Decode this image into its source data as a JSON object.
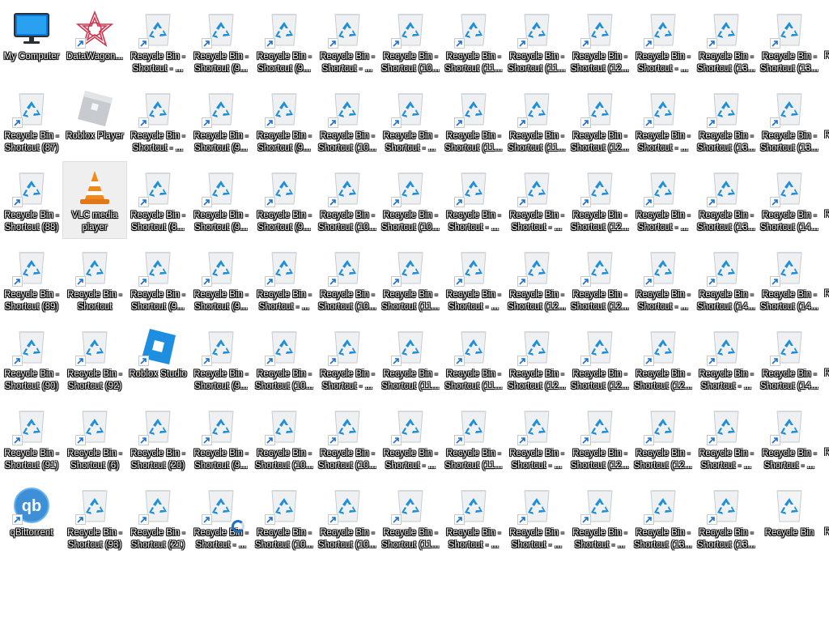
{
  "desktop": {
    "columns": [
      [
        "My Computer",
        "Recycle Bin - Shortcut (87)",
        "Recycle Bin - Shortcut (88)",
        "Recycle Bin - Shortcut (89)",
        "Recycle Bin - Shortcut (90)",
        "Recycle Bin - Shortcut (91)",
        "qBittorrent"
      ],
      [
        "DataWagon...",
        "Roblox Player",
        "VLC media player",
        "Recycle Bin - Shortcut",
        "Recycle Bin - Shortcut (92)",
        "Recycle Bin - Shortcut (6)",
        "Recycle Bin - Shortcut (93)"
      ],
      [
        "Recycle Bin - Shortcut - ...",
        "Recycle Bin - Shortcut - ...",
        "Recycle Bin - Shortcut (8...",
        "Recycle Bin - Shortcut (9...",
        "Roblox Studio",
        "Recycle Bin - Shortcut (20)",
        "Recycle Bin - Shortcut (21)"
      ],
      [
        "Recycle Bin - Shortcut (9...",
        "Recycle Bin - Shortcut (9...",
        "Recycle Bin - Shortcut (9...",
        "Recycle Bin - Shortcut (9...",
        "Recycle Bin - Shortcut (9...",
        "Recycle Bin - Shortcut (9...",
        "Recycle Bin - Shortcut - ..."
      ],
      [
        "Recycle Bin - Shortcut (9...",
        "Recycle Bin - Shortcut (9...",
        "Recycle Bin - Shortcut (9...",
        "Recycle Bin - Shortcut - ...",
        "Recycle Bin - Shortcut (10...",
        "Recycle Bin - Shortcut (10...",
        "Recycle Bin - Shortcut (10..."
      ],
      [
        "Recycle Bin - Shortcut - ...",
        "Recycle Bin - Shortcut (10...",
        "Recycle Bin - Shortcut (10...",
        "Recycle Bin - Shortcut (10...",
        "Recycle Bin - Shortcut - ...",
        "Recycle Bin - Shortcut (10...",
        "Recycle Bin - Shortcut (10..."
      ],
      [
        "Recycle Bin - Shortcut (10...",
        "Recycle Bin - Shortcut - ...",
        "Recycle Bin - Shortcut (10...",
        "Recycle Bin - Shortcut (11...",
        "Recycle Bin - Shortcut (11...",
        "Recycle Bin - Shortcut - ...",
        "Recycle Bin - Shortcut (11..."
      ],
      [
        "Recycle Bin - Shortcut (11...",
        "Recycle Bin - Shortcut (11...",
        "Recycle Bin - Shortcut - ...",
        "Recycle Bin - Shortcut - ...",
        "Recycle Bin - Shortcut (11...",
        "Recycle Bin - Shortcut (11...",
        "Recycle Bin - Shortcut - ..."
      ],
      [
        "Recycle Bin - Shortcut (11...",
        "Recycle Bin - Shortcut (11...",
        "Recycle Bin - Shortcut - ...",
        "Recycle Bin - Shortcut (12...",
        "Recycle Bin - Shortcut (12...",
        "Recycle Bin - Shortcut - ...",
        "Recycle Bin - Shortcut - ..."
      ],
      [
        "Recycle Bin - Shortcut (12...",
        "Recycle Bin - Shortcut (12...",
        "Recycle Bin - Shortcut (12...",
        "Recycle Bin - Shortcut (12...",
        "Recycle Bin - Shortcut (12...",
        "Recycle Bin - Shortcut (12...",
        "Recycle Bin - Shortcut - ..."
      ],
      [
        "Recycle Bin - Shortcut - ...",
        "Recycle Bin - Shortcut - ...",
        "Recycle Bin - Shortcut - ...",
        "Recycle Bin - Shortcut - ...",
        "Recycle Bin - Shortcut (12...",
        "Recycle Bin - Shortcut (12...",
        "Recycle Bin - Shortcut (13..."
      ],
      [
        "Recycle Bin - Shortcut (13...",
        "Recycle Bin - Shortcut (13...",
        "Recycle Bin - Shortcut (13...",
        "Recycle Bin - Shortcut (14...",
        "Recycle Bin - Shortcut - ...",
        "Recycle Bin - Shortcut - ...",
        "Recycle Bin - Shortcut (13..."
      ],
      [
        "Recycle Bin - Shortcut (13...",
        "Recycle Bin - Shortcut (13...",
        "Recycle Bin - Shortcut (14...",
        "Recycle Bin - Shortcut (14...",
        "Recycle Bin - Shortcut (14...",
        "Recycle Bin - Shortcut - ...",
        "Recycle Bin"
      ]
    ],
    "icon_types": [
      [
        "monitor",
        "recycle-shortcut",
        "recycle-shortcut",
        "recycle-shortcut",
        "recycle-shortcut",
        "recycle-shortcut",
        "qbittorrent"
      ],
      [
        "datawagon",
        "roblox-player",
        "vlc",
        "recycle-shortcut",
        "recycle-shortcut",
        "recycle-shortcut",
        "recycle-shortcut"
      ],
      [
        "recycle-shortcut",
        "recycle-shortcut",
        "recycle-shortcut",
        "recycle-shortcut",
        "roblox-studio",
        "recycle-shortcut",
        "recycle-shortcut"
      ],
      [
        "recycle-shortcut",
        "recycle-shortcut",
        "recycle-shortcut",
        "recycle-shortcut",
        "recycle-shortcut",
        "recycle-shortcut",
        "recycle-shortcut"
      ],
      [
        "recycle-shortcut",
        "recycle-shortcut",
        "recycle-shortcut",
        "recycle-shortcut",
        "recycle-shortcut",
        "recycle-shortcut",
        "recycle-shortcut"
      ],
      [
        "recycle-shortcut",
        "recycle-shortcut",
        "recycle-shortcut",
        "recycle-shortcut",
        "recycle-shortcut",
        "recycle-shortcut",
        "recycle-shortcut"
      ],
      [
        "recycle-shortcut",
        "recycle-shortcut",
        "recycle-shortcut",
        "recycle-shortcut",
        "recycle-shortcut",
        "recycle-shortcut",
        "recycle-shortcut"
      ],
      [
        "recycle-shortcut",
        "recycle-shortcut",
        "recycle-shortcut",
        "recycle-shortcut",
        "recycle-shortcut",
        "recycle-shortcut",
        "recycle-shortcut"
      ],
      [
        "recycle-shortcut",
        "recycle-shortcut",
        "recycle-shortcut",
        "recycle-shortcut",
        "recycle-shortcut",
        "recycle-shortcut",
        "recycle-shortcut"
      ],
      [
        "recycle-shortcut",
        "recycle-shortcut",
        "recycle-shortcut",
        "recycle-shortcut",
        "recycle-shortcut",
        "recycle-shortcut",
        "recycle-shortcut"
      ],
      [
        "recycle-shortcut",
        "recycle-shortcut",
        "recycle-shortcut",
        "recycle-shortcut",
        "recycle-shortcut",
        "recycle-shortcut",
        "recycle-shortcut"
      ],
      [
        "recycle-shortcut",
        "recycle-shortcut",
        "recycle-shortcut",
        "recycle-shortcut",
        "recycle-shortcut",
        "recycle-shortcut",
        "recycle-shortcut"
      ],
      [
        "recycle-shortcut",
        "recycle-shortcut",
        "recycle-shortcut",
        "recycle-shortcut",
        "recycle-shortcut",
        "recycle-shortcut",
        "recycle-bin"
      ]
    ],
    "selected_item": "VLC media player",
    "edge_fragments": [
      "R",
      "R",
      "R",
      "R",
      "R",
      "R",
      "R"
    ],
    "colors": {
      "wallpaper": "#ffffff",
      "label_text": "#ffffff",
      "label_shadow": "#000000",
      "busy_cursor": "#1e6fc4"
    }
  }
}
